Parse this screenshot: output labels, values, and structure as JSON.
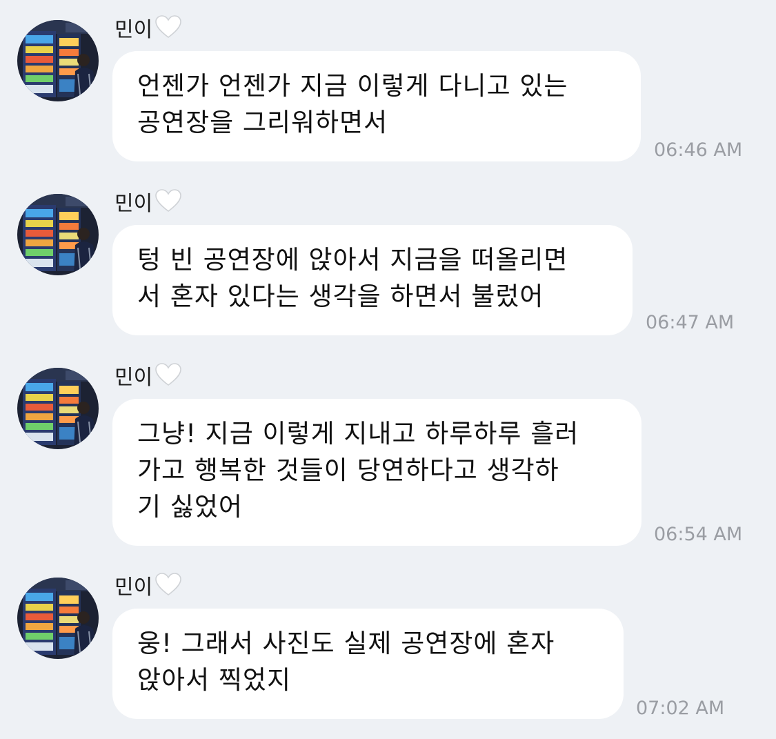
{
  "messages": [
    {
      "sender": "민이",
      "lines": [
        "언젠가 언젠가 지금 이렇게 다니고 있는",
        "공연장을 그리워하면서"
      ],
      "time": "06:46 AM"
    },
    {
      "sender": "민이",
      "lines": [
        "텅 빈 공연장에 앉아서 지금을 떠올리면",
        "서 혼자 있다는 생각을 하면서 불렀어"
      ],
      "time": "06:47 AM"
    },
    {
      "sender": "민이",
      "lines": [
        "그냥! 지금 이렇게 지내고 하루하루 흘러",
        "가고 행복한 것들이 당연하다고 생각하",
        "기 싫었어"
      ],
      "time": "06:54 AM"
    },
    {
      "sender": "민이",
      "lines": [
        "웅! 그래서 사진도 실제 공연장에 혼자",
        "앉아서 찍었지"
      ],
      "time": "07:02 AM"
    }
  ],
  "icons": {
    "name_heart": "white-heart-icon",
    "avatar": "profile-photo"
  },
  "colors": {
    "background": "#eef1f5",
    "bubble": "#ffffff",
    "text": "#111111",
    "timestamp": "#9a9da3",
    "heart": "#ffffff"
  }
}
